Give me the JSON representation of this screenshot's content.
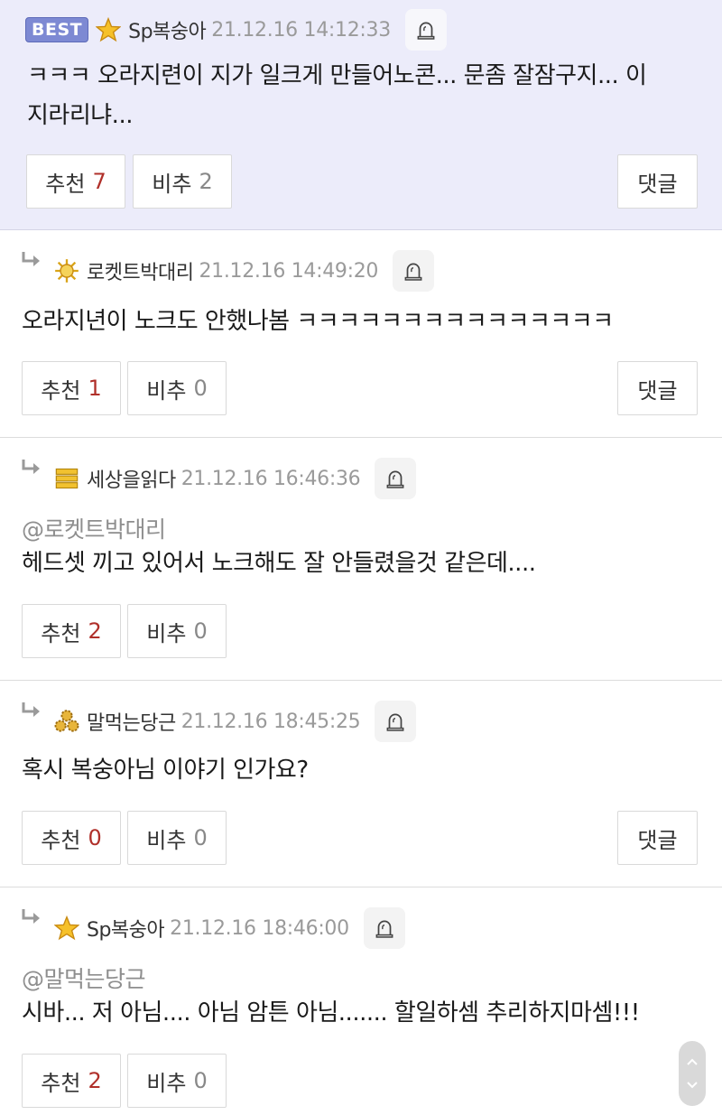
{
  "comments": [
    {
      "best_label": "BEST",
      "nickname": "Sp복숭아",
      "date": "21.12.16 14:12:33",
      "text_lines": [
        "ㅋㅋㅋ 오라지련이 지가 일크게 만들어노콘... 문좀 잘잠구지... 이",
        "지라리냐..."
      ],
      "recommend_label": "추천",
      "recommend_count": "7",
      "not_recommend_label": "비추",
      "not_recommend_count": "2",
      "reply_label": "댓글",
      "level_icon": "star-icon"
    },
    {
      "nickname": "로켓트박대리",
      "date": "21.12.16 14:49:20",
      "text": "오라지년이 노크도 안했나봄 ㅋㅋㅋㅋㅋㅋㅋㅋㅋㅋㅋㅋㅋㅋㅋ",
      "recommend_label": "추천",
      "recommend_count": "1",
      "not_recommend_label": "비추",
      "not_recommend_count": "0",
      "reply_label": "댓글",
      "level_icon": "sun-icon"
    },
    {
      "nickname": "세상을읽다",
      "date": "21.12.16 16:46:36",
      "mention": "@로켓트박대리",
      "text": "헤드셋 끼고 있어서 노크해도 잘 안들렸을것 같은데....",
      "recommend_label": "추천",
      "recommend_count": "2",
      "not_recommend_label": "비추",
      "not_recommend_count": "0",
      "level_icon": "gold-bars-icon"
    },
    {
      "nickname": "말먹는당근",
      "date": "21.12.16 18:45:25",
      "text": "혹시 복숭아님 이야기 인가요?",
      "recommend_label": "추천",
      "recommend_count": "0",
      "not_recommend_label": "비추",
      "not_recommend_count": "0",
      "reply_label": "댓글",
      "level_icon": "gear-cluster-icon"
    },
    {
      "nickname": "Sp복숭아",
      "date": "21.12.16 18:46:00",
      "mention": "@말먹는당근",
      "text": "시바... 저 아님.... 아님 암튼 아님....... 할일하셈 추리하지마셈!!!",
      "recommend_label": "추천",
      "recommend_count": "2",
      "not_recommend_label": "비추",
      "not_recommend_count": "0",
      "level_icon": "star-icon"
    }
  ],
  "colors": {
    "best_bg": "#ececfa",
    "best_badge": "#7d89d3",
    "recommend_count": "#b0302a",
    "date": "#9a9a9a"
  }
}
